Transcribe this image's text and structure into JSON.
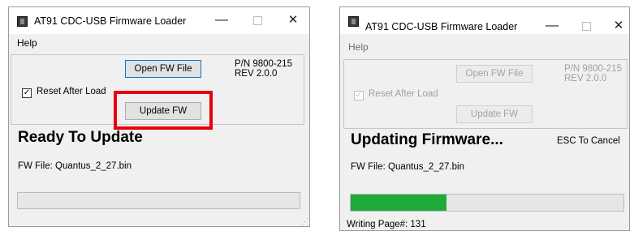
{
  "windows": [
    {
      "title": "AT91 CDC-USB Firmware Loader",
      "menu_help": "Help",
      "controls": {
        "minimize": "—",
        "maximize": "",
        "close": "✕"
      },
      "open_button": "Open FW File",
      "update_button": "Update FW",
      "part_number": "P/N 9800-215",
      "revision": "REV 2.0.0",
      "reset_checkbox": {
        "checked": true,
        "label": "Reset After Load",
        "mark": "✓"
      },
      "status": "Ready To Update",
      "fw_file": "FW File: Quantus_2_27.bin",
      "progress": 0
    },
    {
      "title": "AT91 CDC-USB Firmware Loader",
      "menu_help": "Help",
      "controls": {
        "minimize": "—",
        "maximize": "",
        "close": "✕"
      },
      "open_button": "Open FW File",
      "update_button": "Update FW",
      "part_number": "P/N 9800-215",
      "revision": "REV 2.0.0",
      "reset_checkbox": {
        "checked": true,
        "label": "Reset After Load",
        "mark": "✓"
      },
      "status": "Updating Firmware...",
      "esc_hint": "ESC To Cancel",
      "fw_file": "FW File: Quantus_2_27.bin",
      "progress": 0.35,
      "progress_color": "#1faa3a",
      "statusbar": "Writing Page#: 131"
    }
  ],
  "highlight_color": "#e8000a",
  "accent_focus": "#0078d7"
}
